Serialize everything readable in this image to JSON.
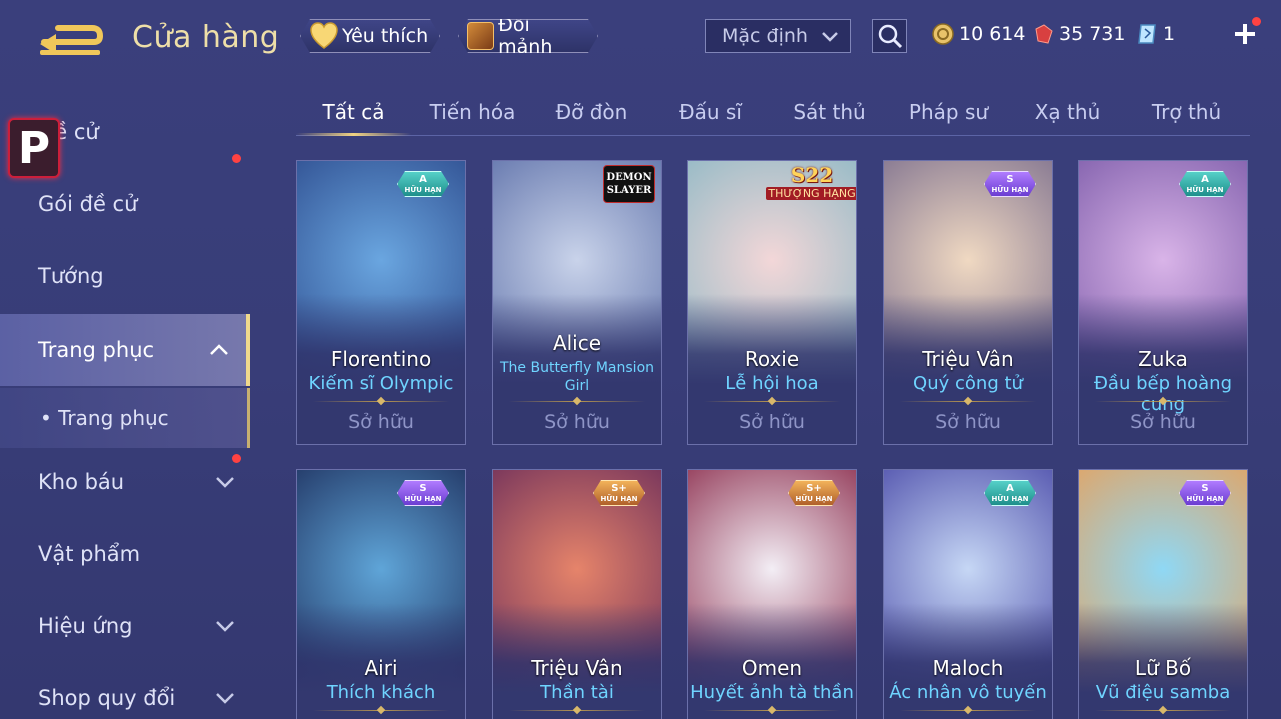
{
  "header": {
    "title": "Cửa hàng",
    "favorites_label": "Yêu thích",
    "trade_label": "Đổi mảnh",
    "sort_value": "Mặc định",
    "gold": "10 614",
    "rubies": "35 731",
    "vouchers": "1"
  },
  "sidebar": {
    "logo_letter": "P",
    "items": [
      {
        "label": "Đề cử"
      },
      {
        "label": "Gói đề cử"
      },
      {
        "label": "Tướng"
      },
      {
        "label": "Trang phục"
      },
      {
        "label": "• Trang phục"
      },
      {
        "label": "Kho báu"
      },
      {
        "label": "Vật phẩm"
      },
      {
        "label": "Hiệu ứng"
      },
      {
        "label": "Shop quy đổi"
      }
    ]
  },
  "tabs": [
    "Tất cả",
    "Tiến hóa",
    "Đỡ đòn",
    "Đấu sĩ",
    "Sát thủ",
    "Pháp sư",
    "Xạ thủ",
    "Trợ thủ"
  ],
  "badges": {
    "limited": "HỮU HẠN",
    "season": "S22",
    "season_label": "THƯỢNG HẠNG",
    "collab_line1": "DEMON",
    "collab_line2": "SLAYER"
  },
  "cards": [
    {
      "hero": "Florentino",
      "skin": "Kiếm sĩ Olympic",
      "owned": "Sở hữu",
      "rank": "A",
      "badge": "teal",
      "art": [
        "#6aa6e0",
        "#2c4a8c"
      ]
    },
    {
      "hero": "Alice",
      "skin": "The Butterfly Mansion Girl",
      "owned": "Sở hữu",
      "rank": "",
      "badge": "collab",
      "art": [
        "#c9d3ea",
        "#5c6fa8"
      ]
    },
    {
      "hero": "Roxie",
      "skin": "Lễ hội hoa",
      "owned": "Sở hữu",
      "rank": "",
      "badge": "season",
      "art": [
        "#f3d7d8",
        "#8bb7c4"
      ]
    },
    {
      "hero": "Triệu Vân",
      "skin": "Quý công tử",
      "owned": "Sở hữu",
      "rank": "S",
      "badge": "purple",
      "art": [
        "#f0d9c2",
        "#7a6d8c"
      ]
    },
    {
      "hero": "Zuka",
      "skin": "Đầu bếp hoàng cung",
      "owned": "Sở hữu",
      "rank": "A",
      "badge": "teal",
      "art": [
        "#d9b4e8",
        "#7b5aa8"
      ]
    },
    {
      "hero": "Airi",
      "skin": "Thích khách",
      "owned": "",
      "rank": "S",
      "badge": "purple",
      "art": [
        "#5fa5d8",
        "#1d2e5c"
      ]
    },
    {
      "hero": "Triệu Vân",
      "skin": "Thần tài",
      "owned": "",
      "rank": "S+",
      "badge": "gold",
      "art": [
        "#e6846a",
        "#6a2c5a"
      ]
    },
    {
      "hero": "Omen",
      "skin": "Huyết ảnh tà thần",
      "owned": "",
      "rank": "S+",
      "badge": "gold",
      "art": [
        "#f3eef5",
        "#8a2a4a"
      ]
    },
    {
      "hero": "Maloch",
      "skin": "Ác nhân vô tuyến",
      "owned": "",
      "rank": "A",
      "badge": "teal",
      "art": [
        "#c6d7f5",
        "#4a4aa8"
      ]
    },
    {
      "hero": "Lữ Bố",
      "skin": "Vũ điệu samba",
      "owned": "",
      "rank": "S",
      "badge": "purple",
      "art": [
        "#8fd8f5",
        "#e8a05a"
      ]
    }
  ]
}
